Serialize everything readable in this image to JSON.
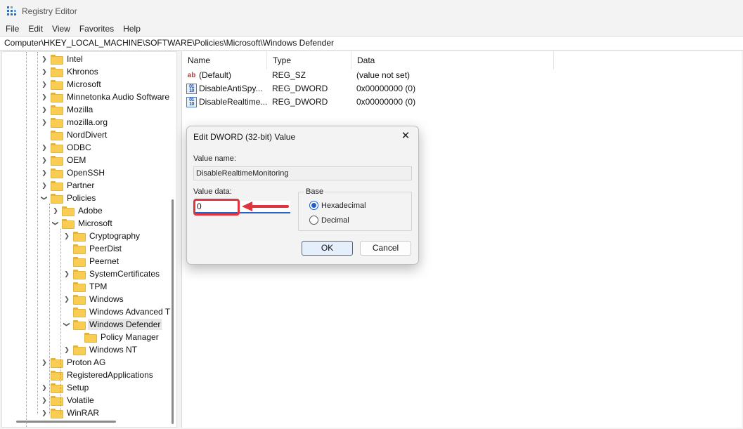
{
  "window": {
    "title": "Registry Editor"
  },
  "menu": [
    "File",
    "Edit",
    "View",
    "Favorites",
    "Help"
  ],
  "address": "Computer\\HKEY_LOCAL_MACHINE\\SOFTWARE\\Policies\\Microsoft\\Windows Defender",
  "tree": [
    {
      "label": "Intel",
      "level": 0,
      "expander": "collapsed"
    },
    {
      "label": "Khronos",
      "level": 0,
      "expander": "collapsed"
    },
    {
      "label": "Microsoft",
      "level": 0,
      "expander": "collapsed"
    },
    {
      "label": "Minnetonka Audio Software",
      "level": 0,
      "expander": "collapsed"
    },
    {
      "label": "Mozilla",
      "level": 0,
      "expander": "collapsed"
    },
    {
      "label": "mozilla.org",
      "level": 0,
      "expander": "collapsed"
    },
    {
      "label": "NordDivert",
      "level": 0,
      "expander": "none"
    },
    {
      "label": "ODBC",
      "level": 0,
      "expander": "collapsed"
    },
    {
      "label": "OEM",
      "level": 0,
      "expander": "collapsed"
    },
    {
      "label": "OpenSSH",
      "level": 0,
      "expander": "collapsed"
    },
    {
      "label": "Partner",
      "level": 0,
      "expander": "collapsed"
    },
    {
      "label": "Policies",
      "level": 0,
      "expander": "expanded"
    },
    {
      "label": "Adobe",
      "level": 1,
      "expander": "collapsed"
    },
    {
      "label": "Microsoft",
      "level": 1,
      "expander": "expanded"
    },
    {
      "label": "Cryptography",
      "level": 2,
      "expander": "collapsed"
    },
    {
      "label": "PeerDist",
      "level": 2,
      "expander": "none"
    },
    {
      "label": "Peernet",
      "level": 2,
      "expander": "none"
    },
    {
      "label": "SystemCertificates",
      "level": 2,
      "expander": "collapsed"
    },
    {
      "label": "TPM",
      "level": 2,
      "expander": "none"
    },
    {
      "label": "Windows",
      "level": 2,
      "expander": "collapsed"
    },
    {
      "label": "Windows Advanced T",
      "level": 2,
      "expander": "none"
    },
    {
      "label": "Windows Defender",
      "level": 2,
      "expander": "expanded",
      "selected": true
    },
    {
      "label": "Policy Manager",
      "level": 3,
      "expander": "none"
    },
    {
      "label": "Windows NT",
      "level": 2,
      "expander": "collapsed"
    },
    {
      "label": "Proton AG",
      "level": 0,
      "expander": "collapsed"
    },
    {
      "label": "RegisteredApplications",
      "level": 0,
      "expander": "none"
    },
    {
      "label": "Setup",
      "level": 0,
      "expander": "collapsed"
    },
    {
      "label": "Volatile",
      "level": 0,
      "expander": "collapsed"
    },
    {
      "label": "WinRAR",
      "level": 0,
      "expander": "collapsed"
    }
  ],
  "list": {
    "columns": [
      "Name",
      "Type",
      "Data"
    ],
    "rows": [
      {
        "name": "(Default)",
        "type": "REG_SZ",
        "data": "(value not set)",
        "icon": "string-value-icon"
      },
      {
        "name": "DisableAntiSpy...",
        "type": "REG_DWORD",
        "data": "0x00000000 (0)",
        "icon": "dword-value-icon"
      },
      {
        "name": "DisableRealtime...",
        "type": "REG_DWORD",
        "data": "0x00000000 (0)",
        "icon": "dword-value-icon"
      }
    ]
  },
  "dialog": {
    "title": "Edit DWORD (32-bit) Value",
    "value_name_label": "Value name:",
    "value_name": "DisableRealtimeMonitoring",
    "value_data_label": "Value data:",
    "value_data": "0",
    "base_label": "Base",
    "base_options": [
      "Hexadecimal",
      "Decimal"
    ],
    "base_selected": "Hexadecimal",
    "ok_label": "OK",
    "cancel_label": "Cancel",
    "close_glyph": "✕"
  },
  "colors": {
    "annotation": "#e0353f",
    "accent": "#2563c9",
    "folder": "#f8cd52"
  }
}
